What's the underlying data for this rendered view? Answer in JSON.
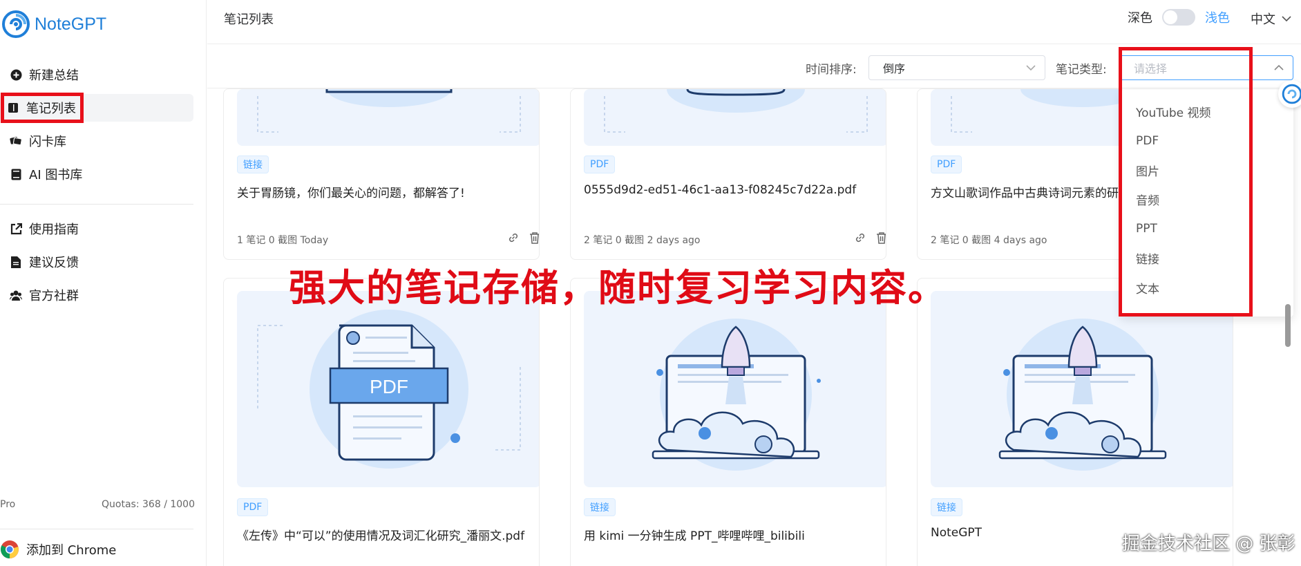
{
  "app": {
    "name": "NoteGPT",
    "brand_color": "#1f7fd8",
    "accent": "#409eff",
    "highlight": "#e8101a"
  },
  "sidebar": {
    "items": [
      {
        "label": "新建总结",
        "icon": "plus-circle-icon"
      },
      {
        "label": "笔记列表",
        "icon": "book-icon",
        "active": true
      },
      {
        "label": "闪卡库",
        "icon": "cards-icon"
      },
      {
        "label": "AI 图书库",
        "icon": "library-icon"
      }
    ],
    "items2": [
      {
        "label": "使用指南",
        "icon": "external-link-icon"
      },
      {
        "label": "建议反馈",
        "icon": "document-icon"
      },
      {
        "label": "官方社群",
        "icon": "community-icon"
      }
    ],
    "plan": "Pro",
    "quota": "Quotas: 368 / 1000",
    "chrome": "添加到 Chrome"
  },
  "header": {
    "title": "笔记列表",
    "dark_label": "深色",
    "light_label": "浅色",
    "lang": "中文"
  },
  "filters": {
    "sort_label": "时间排序:",
    "sort_value": "倒序",
    "type_label": "笔记类型:",
    "type_placeholder": "请选择"
  },
  "dropdown": {
    "options": [
      "YouTube 视频",
      "PDF",
      "图片",
      "音频",
      "PPT",
      "链接",
      "文本"
    ]
  },
  "cards": [
    {
      "tag": "链接",
      "title": "关于胃肠镜，你们最关心的问题，都解答了!",
      "meta": "1 笔记  0 截图  Today"
    },
    {
      "tag": "PDF",
      "title": "0555d9d2-ed51-46c1-aa13-f08245c7d22a.pdf",
      "meta": "2 笔记  0 截图  2 days ago"
    },
    {
      "tag": "PDF",
      "title": "方文山歌词作品中古典诗词元素的研究",
      "meta": "2 笔记  0 截图  4 days ago"
    },
    {
      "tag": "PDF",
      "title": "《左传》中“可以”的使用情况及词汇化研究_潘丽文.pdf",
      "thumb_text": "PDF"
    },
    {
      "tag": "链接",
      "title": "用 kimi 一分钟生成 PPT_哔哩哔哩_bilibili"
    },
    {
      "tag": "链接",
      "title": "NoteGPT"
    }
  ],
  "banner": "强大的笔记存储，随时复习学习内容。",
  "watermark": "掘金技术社区 @ 张彰"
}
